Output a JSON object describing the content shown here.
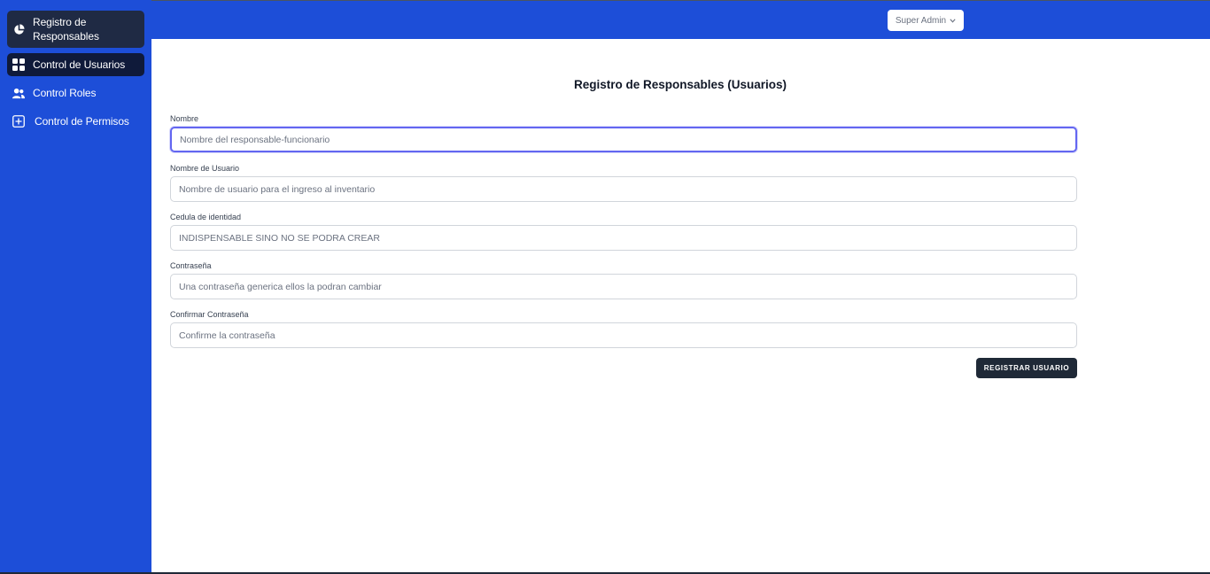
{
  "sidebar": {
    "items": [
      {
        "label": "Registro de Responsables",
        "icon": "pie-chart-icon"
      },
      {
        "label": "Control de Usuarios",
        "icon": "grid-icon"
      },
      {
        "label": "Control Roles",
        "icon": "users-icon"
      },
      {
        "label": "Control de Permisos",
        "icon": "plus-square-icon"
      }
    ]
  },
  "header": {
    "user_menu_label": "Super Admin",
    "user_menu_icon": "chevron-down-icon"
  },
  "form": {
    "title": "Registro de Responsables (Usuarios)",
    "fields": [
      {
        "label": "Nombre",
        "placeholder": "Nombre del responsable-funcionario"
      },
      {
        "label": "Nombre de Usuario",
        "placeholder": "Nombre de usuario para el ingreso al inventario"
      },
      {
        "label": "Cedula de identidad",
        "placeholder": "INDISPENSABLE SINO NO SE PODRA CREAR"
      },
      {
        "label": "Contraseña",
        "placeholder": "Una contraseña generica ellos la podran cambiar"
      },
      {
        "label": "Confirmar Contraseña",
        "placeholder": "Confirme la contraseña"
      }
    ],
    "submit_label": "REGISTRAR USUARIO"
  },
  "colors": {
    "brand": "#1d4ed8",
    "dark_button": "#1f2937",
    "focus_ring": "#6366f1"
  }
}
